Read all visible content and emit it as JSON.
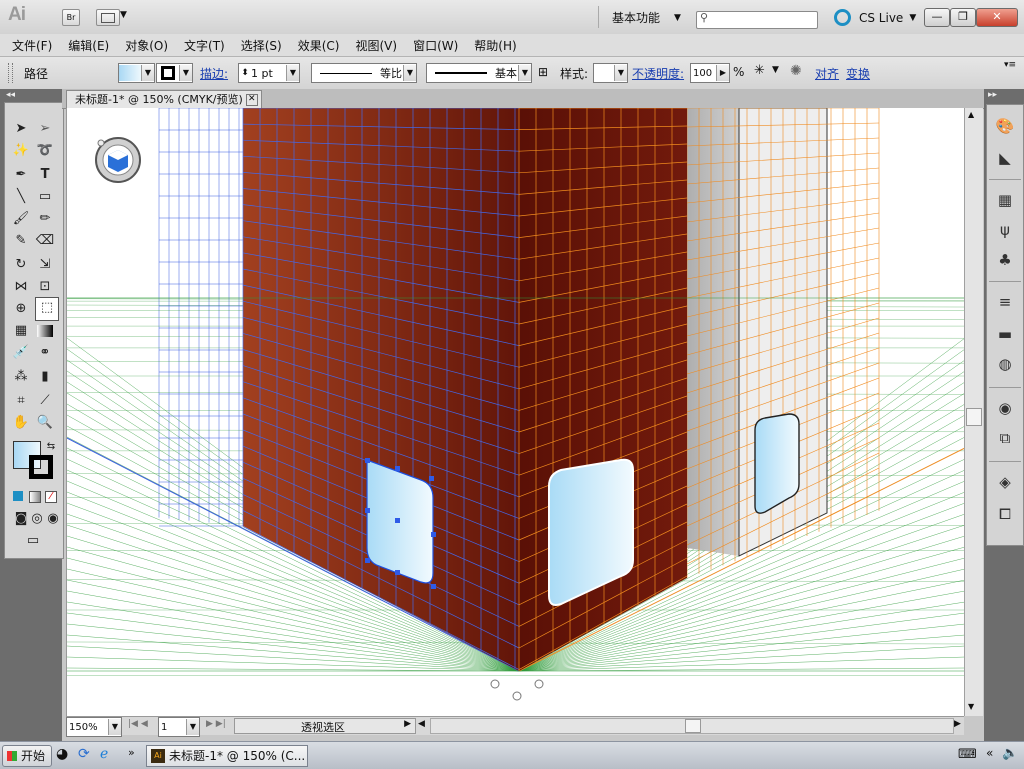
{
  "app": {
    "logo": "Ai",
    "bridge_label": "Br",
    "workspace_label": "基本功能",
    "cs_live_label": "CS Live",
    "window_controls": [
      "minimize-icon",
      "restore-icon",
      "close-icon"
    ]
  },
  "menu": {
    "items": [
      "文件(F)",
      "编辑(E)",
      "对象(O)",
      "文字(T)",
      "选择(S)",
      "效果(C)",
      "视图(V)",
      "窗口(W)",
      "帮助(H)"
    ]
  },
  "control_bar": {
    "object_type": "路径",
    "stroke_label": "描边:",
    "stroke_weight": "1 pt",
    "stroke_profile": "等比",
    "brush_def": "基本",
    "style_label": "样式:",
    "opacity_label": "不透明度:",
    "opacity_value": "100",
    "opacity_unit": "%",
    "align_label": "对齐",
    "transform_label": "变换"
  },
  "document": {
    "tab_title": "未标题-1* @ 150% (CMYK/预览)"
  },
  "status_bar": {
    "zoom": "150%",
    "artboard": "1",
    "tool_info": "透视选区"
  },
  "taskbar": {
    "start_label": "开始",
    "task_item": "未标题-1* @ 150% (C..."
  },
  "colors": {
    "wall_left": "#9a3a1e",
    "wall_right": "#5e1208",
    "grid_left": "#3a5fe0",
    "grid_right": "#f08a1e",
    "grid_ground": "#2f9a3a",
    "window_fill": "#cfe9f8"
  }
}
